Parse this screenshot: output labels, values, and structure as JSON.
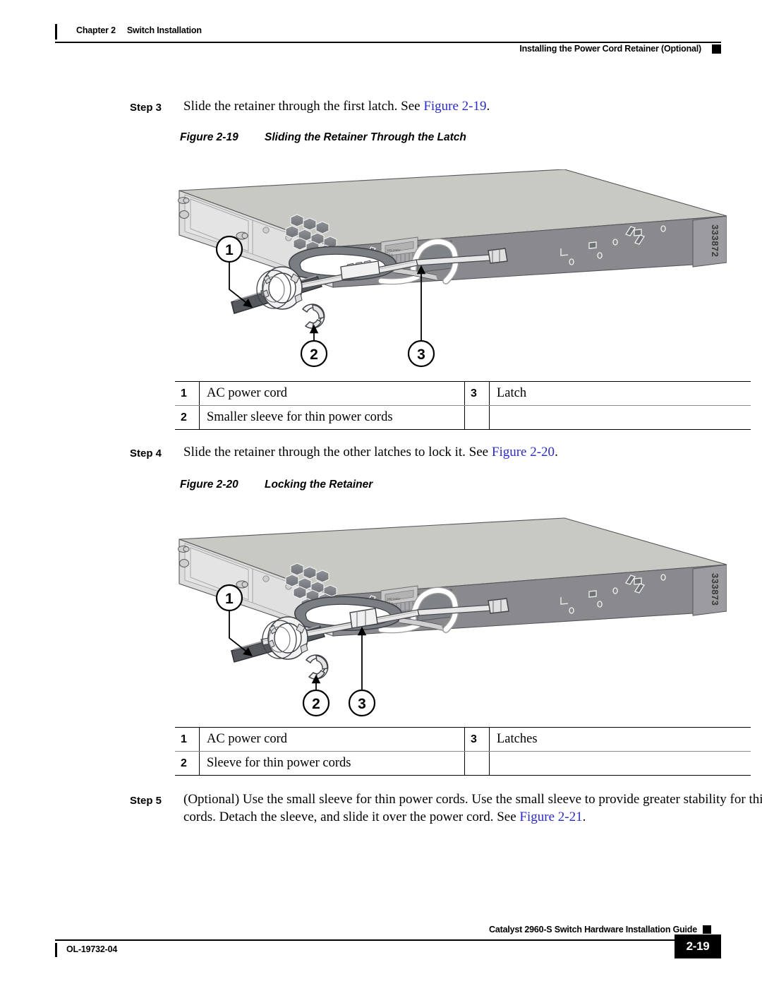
{
  "header": {
    "chapter": "Chapter 2",
    "chapter_title": "Switch Installation",
    "section": "Installing the Power Cord Retainer (Optional)"
  },
  "steps": [
    {
      "label": "Step 3",
      "text_before": "Slide the retainer through the first latch. See ",
      "xref": "Figure 2-19",
      "text_after": "."
    },
    {
      "label": "Step 4",
      "text_before": "Slide the retainer through the other latches to lock it. See ",
      "xref": "Figure 2-20",
      "text_after": "."
    },
    {
      "label": "Step 5",
      "text_before": "(Optional) Use the small sleeve for thin power cords. Use the small sleeve to provide greater stability for thin cords. Detach the sleeve, and slide it over the power cord. See ",
      "xref": "Figure 2-21",
      "text_after": "."
    }
  ],
  "figures": [
    {
      "number": "Figure 2-19",
      "title": "Sliding the Retainer Through the Latch",
      "art_id": "333872",
      "callouts": [
        "1",
        "2",
        "3"
      ],
      "legend": [
        {
          "n1": "1",
          "t1": "AC power cord",
          "n2": "3",
          "t2": "Latch"
        },
        {
          "n1": "2",
          "t1": "Smaller sleeve for thin power cords",
          "n2": "",
          "t2": ""
        }
      ]
    },
    {
      "number": "Figure 2-20",
      "title": "Locking the Retainer",
      "art_id": "333873",
      "callouts": [
        "1",
        "2",
        "3"
      ],
      "legend": [
        {
          "n1": "1",
          "t1": "AC power cord",
          "n2": "3",
          "t2": "Latches"
        },
        {
          "n1": "2",
          "t1": "Sleeve for thin power cords",
          "n2": "",
          "t2": ""
        }
      ]
    }
  ],
  "footer": {
    "guide_title": "Catalyst 2960-S Switch Hardware Installation Guide",
    "doc_id": "OL-19732-04",
    "page_number": "2-19"
  },
  "colors": {
    "link": "#2b2bc8",
    "chassis_top": "#c9c9c4",
    "chassis_front": "#dddddd",
    "chassis_rear": "#8a8a8e",
    "cord_dark": "#6e7278",
    "rule": "#000000"
  }
}
